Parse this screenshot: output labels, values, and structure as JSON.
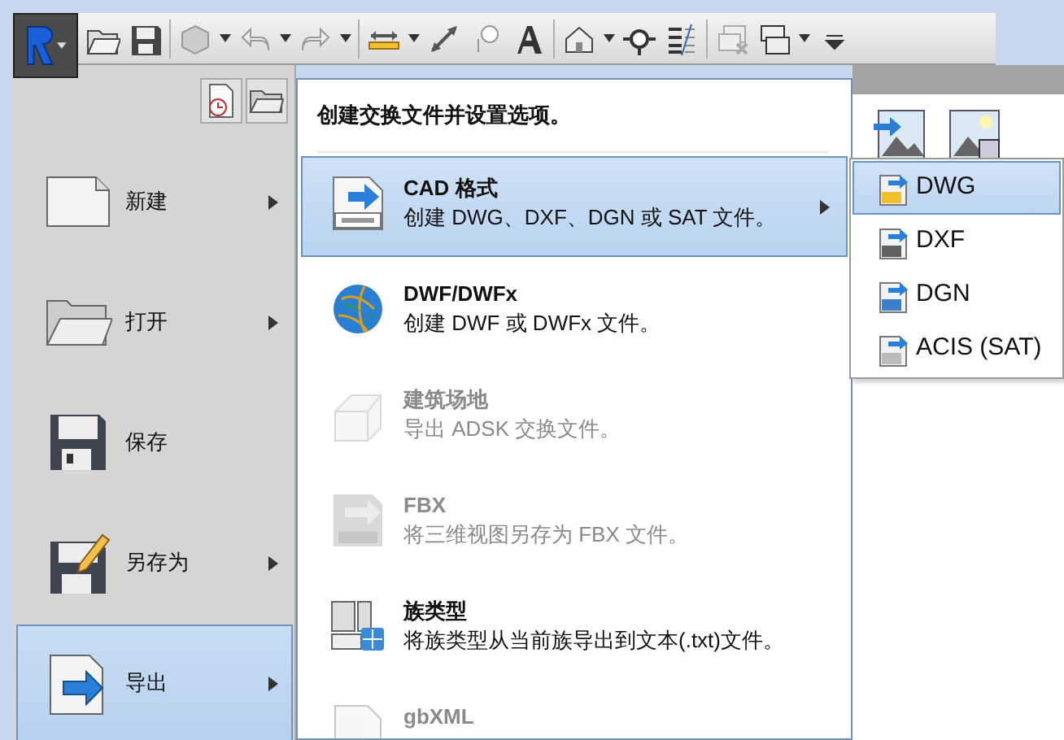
{
  "left_menu": {
    "items": [
      {
        "label": "新建",
        "submenu": true,
        "selected": false
      },
      {
        "label": "打开",
        "submenu": true,
        "selected": false
      },
      {
        "label": "保存",
        "submenu": false,
        "selected": false
      },
      {
        "label": "另存为",
        "submenu": true,
        "selected": false
      },
      {
        "label": "导出",
        "submenu": true,
        "selected": true
      }
    ]
  },
  "export_panel": {
    "header": "创建交换文件并设置选项。",
    "items": [
      {
        "title": "CAD 格式",
        "description": "创建 DWG、DXF、DGN 或 SAT 文件。",
        "submenu": true,
        "selected": true,
        "disabled": false
      },
      {
        "title": "DWF/DWFx",
        "description": "创建 DWF 或 DWFx 文件。",
        "submenu": false,
        "selected": false,
        "disabled": false
      },
      {
        "title": "建筑场地",
        "description": "导出 ADSK 交换文件。",
        "submenu": false,
        "selected": false,
        "disabled": true
      },
      {
        "title": "FBX",
        "description": "将三维视图另存为 FBX 文件。",
        "submenu": false,
        "selected": false,
        "disabled": true
      },
      {
        "title": "族类型",
        "description": "将族类型从当前族导出到文本(.txt)文件。",
        "submenu": false,
        "selected": false,
        "disabled": false
      },
      {
        "title": "gbXML",
        "submenu": false,
        "selected": false,
        "disabled": true
      }
    ]
  },
  "cad_submenu": {
    "items": [
      {
        "label": "DWG",
        "selected": true
      },
      {
        "label": "DXF",
        "selected": false
      },
      {
        "label": "DGN",
        "selected": false
      },
      {
        "label": "ACIS (SAT)",
        "selected": false
      }
    ]
  }
}
